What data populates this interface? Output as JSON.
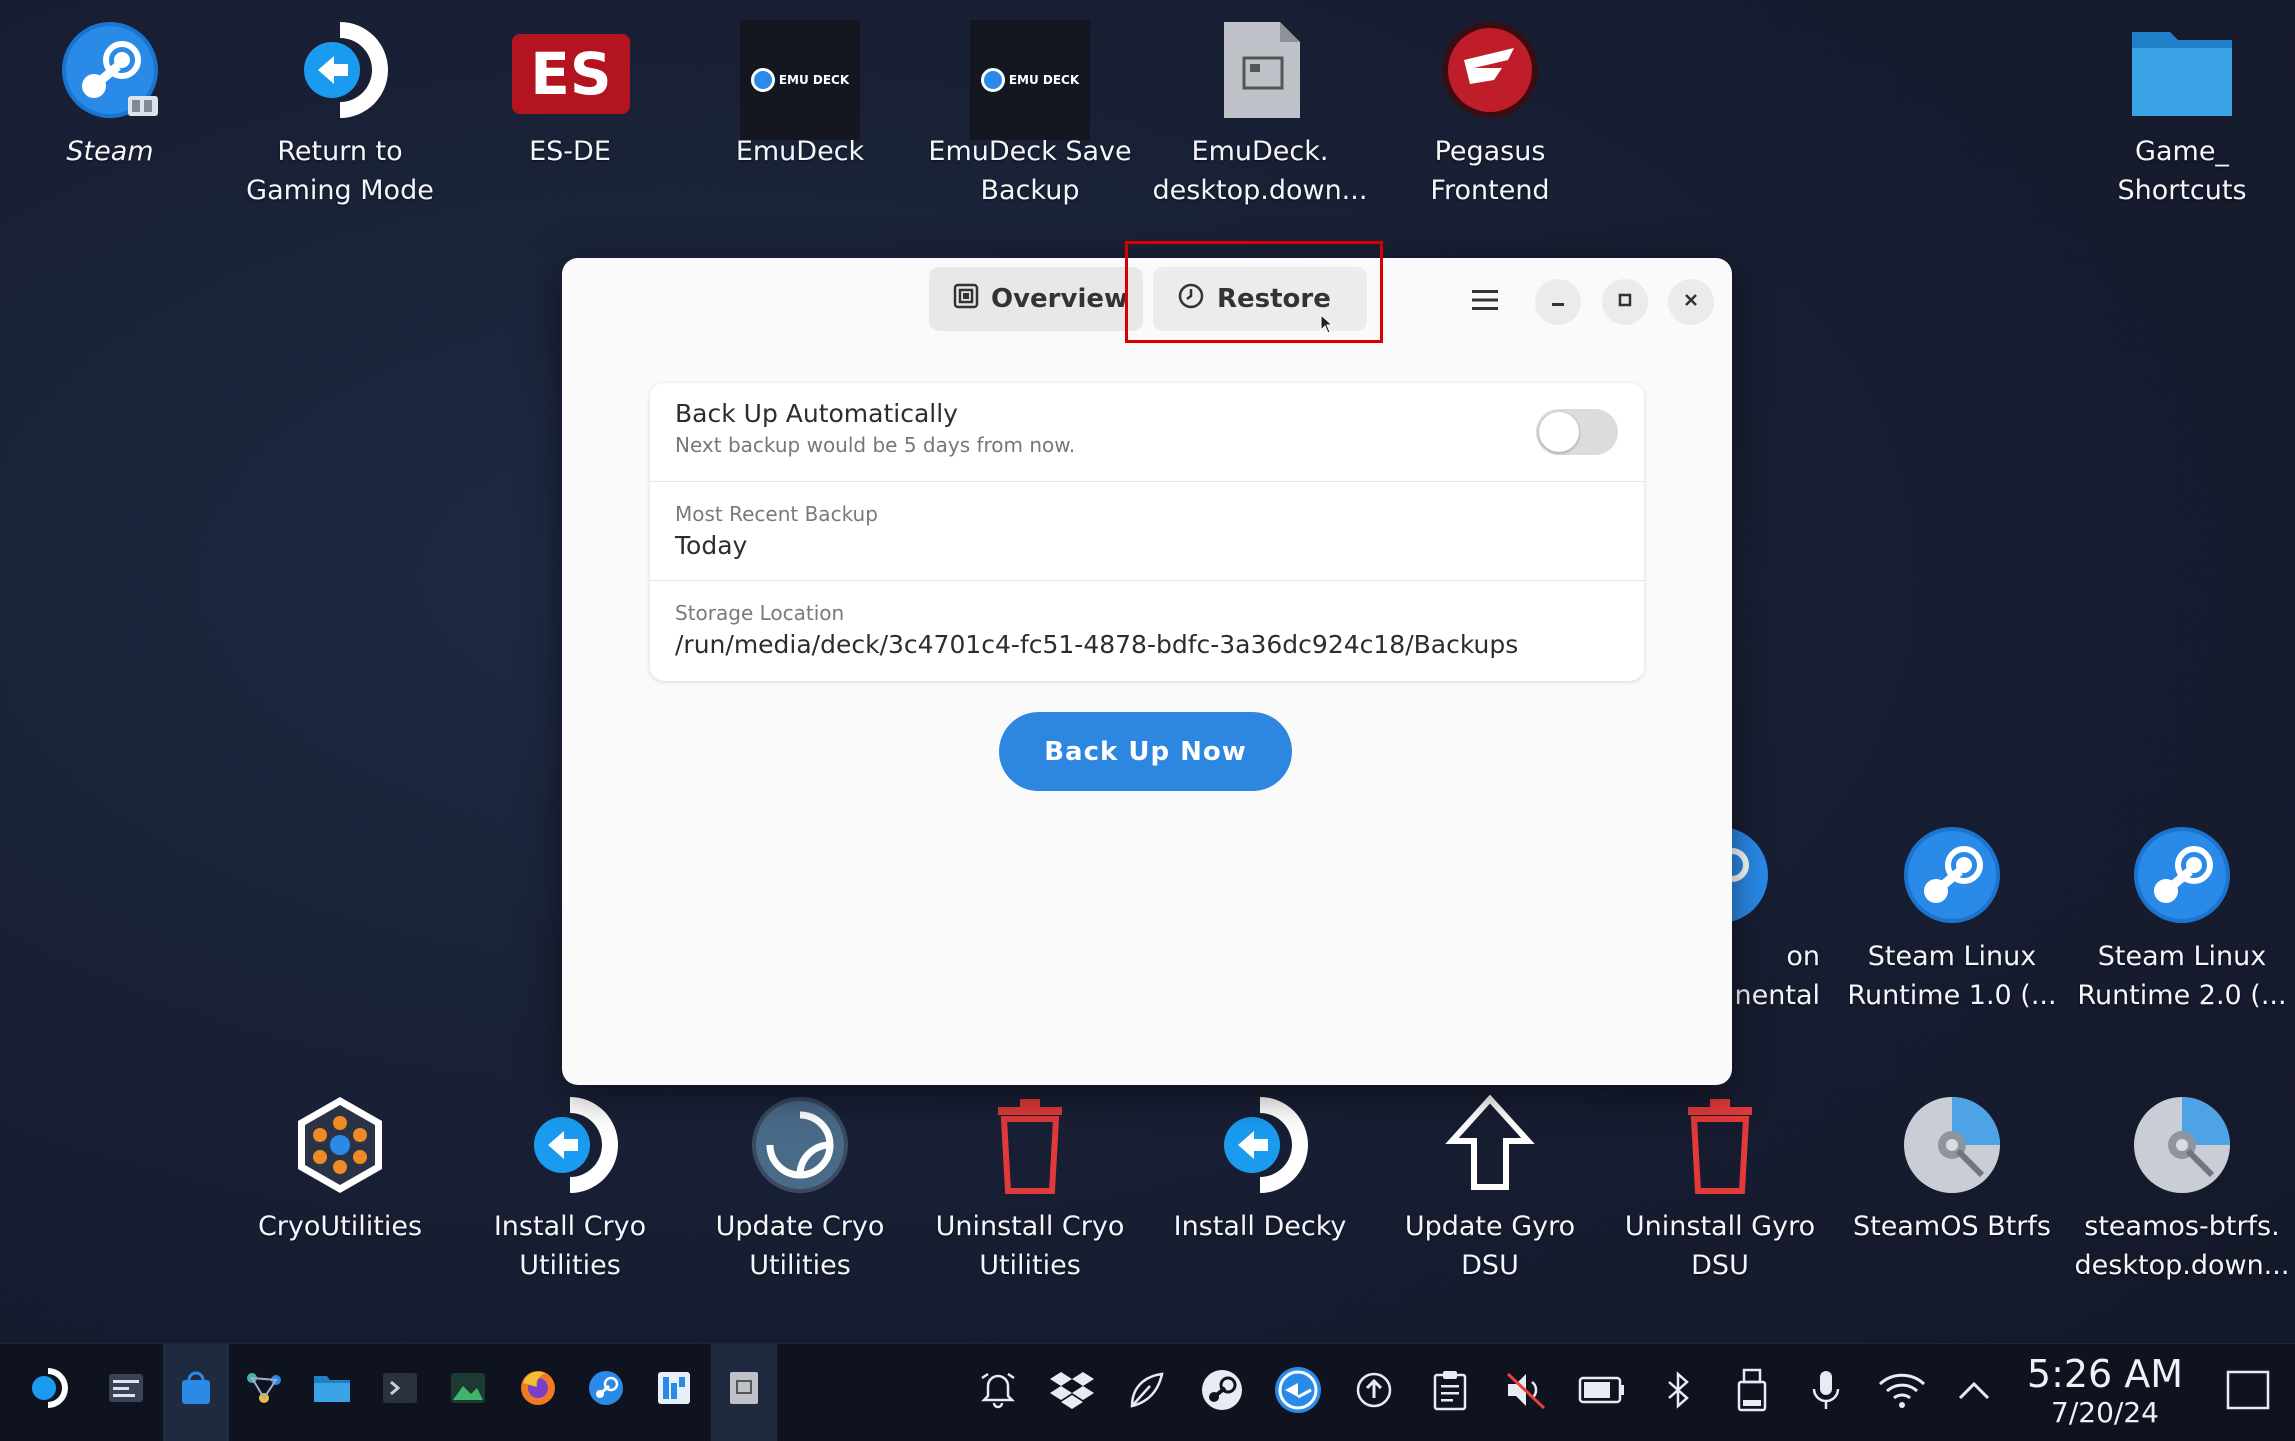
{
  "desktop": {
    "top_icons": [
      {
        "name": "steam",
        "label": "Steam"
      },
      {
        "name": "return-to-gaming-mode",
        "label": "Return to\nGaming Mode"
      },
      {
        "name": "es-de",
        "label": "ES-DE"
      },
      {
        "name": "emudeck",
        "label": "EmuDeck"
      },
      {
        "name": "emudeck-save-backup",
        "label": "EmuDeck Save\nBackup"
      },
      {
        "name": "emudeck-desktop-download",
        "label": "EmuDeck.\ndesktop.down..."
      },
      {
        "name": "pegasus-frontend",
        "label": "Pegasus\nFrontend"
      },
      {
        "name": "game-shortcuts",
        "label": "Game_\nShortcuts"
      }
    ],
    "mid_icons": [
      {
        "name": "partial-experimental",
        "label": "on\nnental"
      },
      {
        "name": "steam-linux-runtime-1",
        "label": "Steam Linux\nRuntime 1.0 (..."
      },
      {
        "name": "steam-linux-runtime-2",
        "label": "Steam Linux\nRuntime 2.0 (..."
      }
    ],
    "bottom_icons": [
      {
        "name": "cryoutilities",
        "label": "CryoUtilities"
      },
      {
        "name": "install-cryo-utilities",
        "label": "Install Cryo\nUtilities"
      },
      {
        "name": "update-cryo-utilities",
        "label": "Update Cryo\nUtilities"
      },
      {
        "name": "uninstall-cryo-utilities",
        "label": "Uninstall Cryo\nUtilities"
      },
      {
        "name": "install-decky",
        "label": "Install Decky"
      },
      {
        "name": "update-gyro-dsu",
        "label": "Update Gyro\nDSU"
      },
      {
        "name": "uninstall-gyro-dsu",
        "label": "Uninstall Gyro\nDSU"
      },
      {
        "name": "steamos-btrfs",
        "label": "SteamOS Btrfs"
      },
      {
        "name": "steamos-btrfs-desktop-download",
        "label": "steamos-btrfs.\ndesktop.down..."
      }
    ],
    "es_logo_text": "ES",
    "emudeck_logo_text": "EMU DECK"
  },
  "dialog": {
    "tabs": {
      "overview": "Overview",
      "restore": "Restore"
    },
    "auto_backup": {
      "title": "Back Up Automatically",
      "subtitle": "Next backup would be 5 days from now.",
      "enabled": false
    },
    "recent_backup": {
      "label": "Most Recent Backup",
      "value": "Today"
    },
    "storage": {
      "label": "Storage Location",
      "value": "/run/media/deck/3c4701c4-fc51-4878-bdfc-3a36dc924c18/Backups"
    },
    "backup_button": "Back Up Now"
  },
  "taskbar": {
    "time": "5:26 AM",
    "date": "7/20/24"
  },
  "colors": {
    "accent": "#2d86e0",
    "highlight": "#d90000"
  }
}
